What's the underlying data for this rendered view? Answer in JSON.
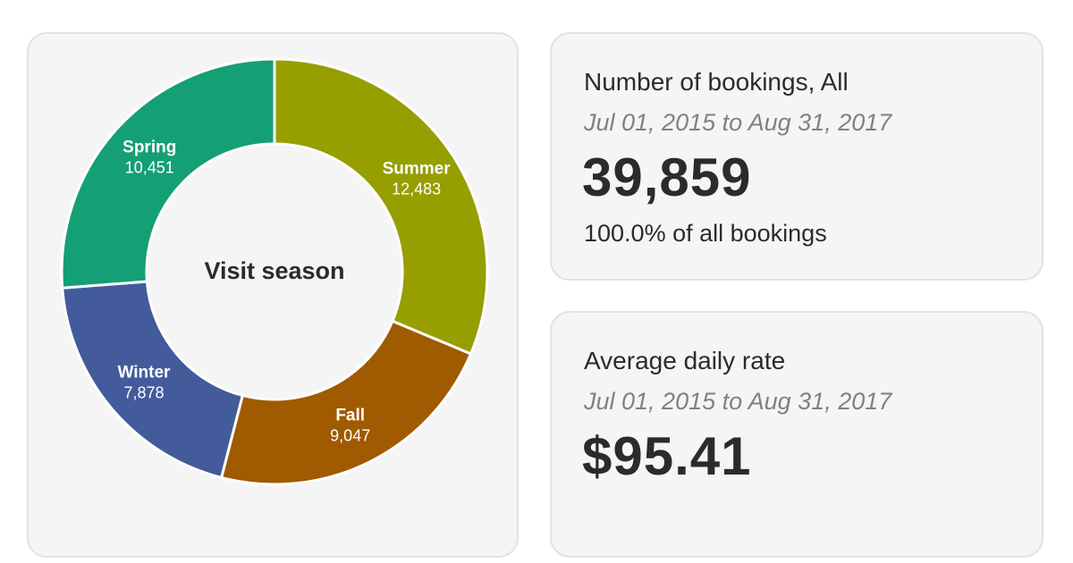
{
  "chart_data": {
    "type": "pie",
    "title": "Visit season",
    "categories": [
      "Summer",
      "Fall",
      "Winter",
      "Spring"
    ],
    "values": [
      12483,
      9047,
      7878,
      10451
    ],
    "labels": [
      "12,483",
      "9,047",
      "7,878",
      "10,451"
    ],
    "colors": [
      "#979e00",
      "#a05a00",
      "#435b9b",
      "#159f74"
    ],
    "donut": true,
    "legend": "none"
  },
  "kpis": {
    "bookings": {
      "title": "Number of bookings, All",
      "range": "Jul 01, 2015 to Aug 31, 2017",
      "value": "39,859",
      "subtext": "100.0% of all bookings"
    },
    "adr": {
      "title": "Average daily rate",
      "range": "Jul 01, 2015 to Aug 31, 2017",
      "value": "$95.41"
    }
  }
}
